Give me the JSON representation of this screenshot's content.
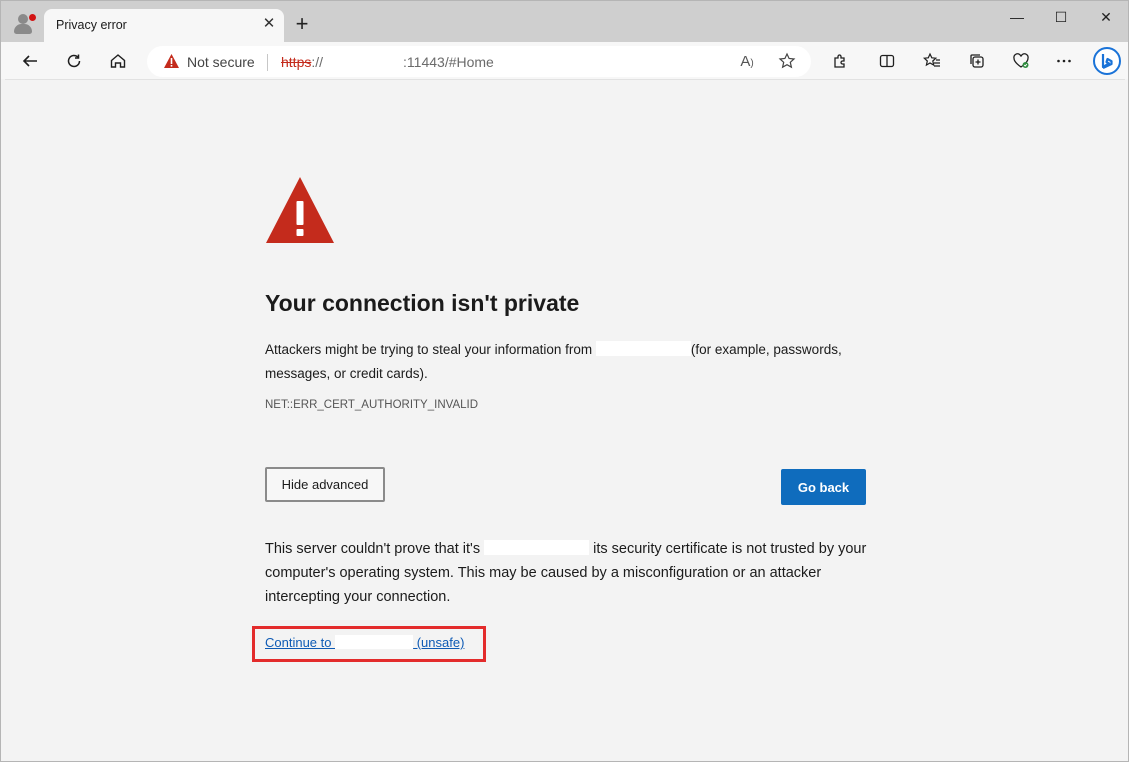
{
  "tab": {
    "title": "Privacy error",
    "close_glyph": "✕"
  },
  "newtab_glyph": "+",
  "window_controls": {
    "minimize": "—",
    "maximize": "☐",
    "close": "✕"
  },
  "omnibox": {
    "security_label": "Not secure",
    "url_scheme": "https",
    "url_scheme_suffix": "://",
    "url_rest": ":11443/#Home"
  },
  "page": {
    "heading": "Your connection isn't private",
    "para_before": "Attackers might be trying to steal your information from ",
    "para_after": "(for example, passwords, messages, or credit cards).",
    "error_code": "NET::ERR_CERT_AUTHORITY_INVALID",
    "hide_advanced_label": "Hide advanced",
    "go_back_label": "Go back",
    "details_before": "This server couldn't prove that it's ",
    "details_after": " its security certificate is not trusted by your computer's operating system. This may be caused by a misconfiguration or an attacker intercepting your connection.",
    "continue_prefix": "Continue to ",
    "continue_suffix": " (unsafe)"
  },
  "colors": {
    "warning_red": "#c42b1c",
    "accent_blue": "#0f6cbd",
    "highlight_red": "#e32b2b"
  },
  "icons": [
    "profile-icon",
    "close-icon",
    "new-tab-icon",
    "back-icon",
    "refresh-icon",
    "home-icon",
    "warning-icon",
    "read-aloud-icon",
    "favorite-star-icon",
    "extensions-icon",
    "split-screen-icon",
    "favorites-icon",
    "collections-icon",
    "browser-essentials-icon",
    "more-icon",
    "bing-copilot-icon"
  ]
}
